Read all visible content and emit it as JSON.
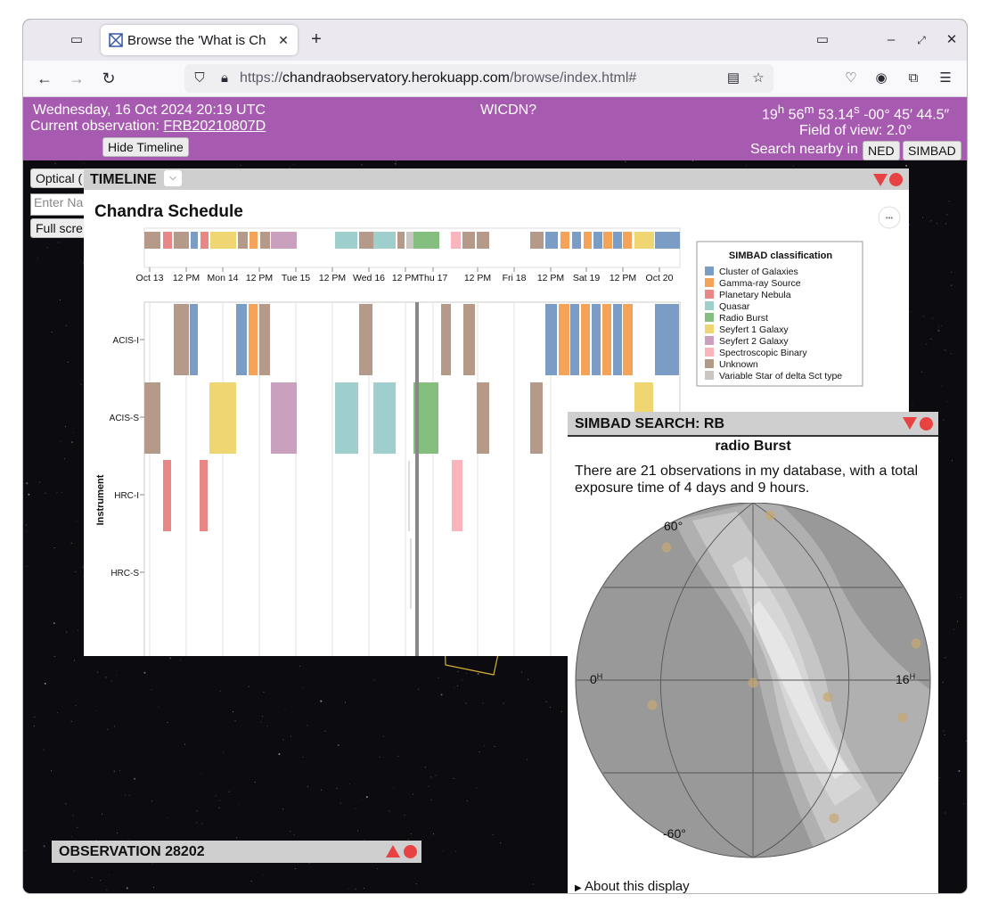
{
  "browser": {
    "tab_title": "Browse the 'What is Ch",
    "url_prefix": "https://",
    "url_host": "chandraobservatory.herokuapp.com",
    "url_path": "/browse/index.html#"
  },
  "banner": {
    "date": "Wednesday, 16 Oct 2024 20:19 UTC",
    "current_obs_label": "Current observation:",
    "current_obs_link": "FRB20210807D",
    "hide_timeline": "Hide Timeline",
    "wicdn": "WICDN?",
    "ra_h": "19",
    "ra_m": "56",
    "ra_s": "53.14",
    "dec": "-00° 45′ 44.5″",
    "field_of_view": "Field of view: 2.0°",
    "search_nearby": "Search nearby in",
    "ned": "NED",
    "simbad": "SIMBAD"
  },
  "left_controls": {
    "optical": "Optical (",
    "enter_name": "Enter Na",
    "full_screen": "Full scre"
  },
  "timeline": {
    "header": "TIMELINE",
    "title": "Chandra Schedule",
    "menu_dots": "•••",
    "day_ticks": [
      "Oct 13",
      "12 PM",
      "Mon 14",
      "12 PM",
      "Tue 15",
      "12 PM",
      "Wed 16",
      "12 PM",
      "Thu 17",
      "12 PM",
      "Fri 18",
      "12 PM",
      "Sat 19",
      "12 PM",
      "Oct 20"
    ],
    "day_ticks_main": [
      "Oct 13",
      "12 PM",
      "Mon 14",
      "12 PM",
      "Tue 15",
      "12 PM",
      "Wed 16",
      "12 PM",
      "Thu 17",
      "12 PM",
      "Fri 18",
      "12 PM"
    ],
    "y_title": "Instrument",
    "instruments": [
      "ACIS-I",
      "ACIS-S",
      "HRC-I",
      "HRC-S"
    ],
    "legend_title": "SIMBAD classification",
    "legend": [
      {
        "label": "Cluster of Galaxies",
        "color": "#7b9cc4"
      },
      {
        "label": "Gamma-ray Source",
        "color": "#f6a35a"
      },
      {
        "label": "Planetary Nebula",
        "color": "#e88785"
      },
      {
        "label": "Quasar",
        "color": "#9ecfcc"
      },
      {
        "label": "Radio Burst",
        "color": "#84bf80"
      },
      {
        "label": "Seyfert 1 Galaxy",
        "color": "#f0d672"
      },
      {
        "label": "Seyfert 2 Galaxy",
        "color": "#c9a0bd"
      },
      {
        "label": "Spectroscopic Binary",
        "color": "#f9b5bb"
      },
      {
        "label": "Unknown",
        "color": "#b59a8a"
      },
      {
        "label": "Variable Star of delta Sct type",
        "color": "#c9c6c3"
      }
    ]
  },
  "simbad_panel": {
    "header": "SIMBAD SEARCH: RB",
    "title": "radio Burst",
    "text": "There are 21 observations in my database, with a total exposure time of 4 days and 9 hours.",
    "lat_top": "60°",
    "lat_bottom": "-60°",
    "ra_left": "0",
    "ra_right": "16",
    "ra_unit": "H",
    "about": "About this display"
  },
  "observation_panel": {
    "header": "OBSERVATION 28202"
  }
}
